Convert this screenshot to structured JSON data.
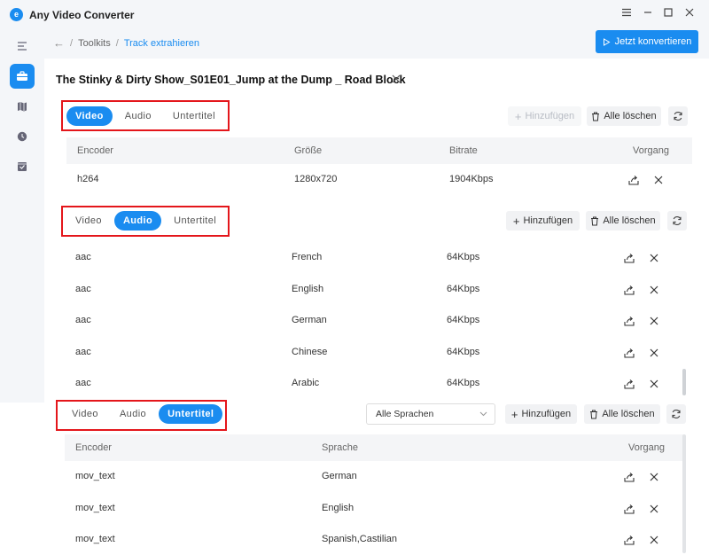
{
  "app": {
    "title": "Any Video Converter",
    "logo_letter": "e"
  },
  "breadcrumb": {
    "back": "←",
    "sep": "/",
    "toolkits": "Toolkits",
    "current": "Track extrahieren"
  },
  "actions": {
    "convert_label": "Jetzt konvertieren"
  },
  "file": {
    "title": "The Stinky & Dirty Show_S01E01_Jump at the Dump _ Road Block"
  },
  "tabs": {
    "video": "Video",
    "audio": "Audio",
    "subtitle": "Untertitel"
  },
  "toolbar": {
    "add": "Hinzufügen",
    "clear_all": "Alle löschen"
  },
  "video_section": {
    "columns": [
      "Encoder",
      "Größe",
      "Bitrate",
      "Vorgang"
    ],
    "rows": [
      {
        "encoder": "h264",
        "size": "1280x720",
        "bitrate": "1904Kbps"
      }
    ]
  },
  "audio_section": {
    "rows": [
      {
        "encoder": "aac",
        "language": "French",
        "bitrate": "64Kbps"
      },
      {
        "encoder": "aac",
        "language": "English",
        "bitrate": "64Kbps"
      },
      {
        "encoder": "aac",
        "language": "German",
        "bitrate": "64Kbps"
      },
      {
        "encoder": "aac",
        "language": "Chinese",
        "bitrate": "64Kbps"
      },
      {
        "encoder": "aac",
        "language": "Arabic",
        "bitrate": "64Kbps"
      }
    ]
  },
  "subtitle_section": {
    "language_select": "Alle Sprachen",
    "columns": [
      "Encoder",
      "Sprache",
      "Vorgang"
    ],
    "rows": [
      {
        "encoder": "mov_text",
        "language": "German"
      },
      {
        "encoder": "mov_text",
        "language": "English"
      },
      {
        "encoder": "mov_text",
        "language": "Spanish,Castilian"
      }
    ]
  },
  "colors": {
    "accent": "#1a8cf0",
    "highlight": "#e4161b"
  }
}
